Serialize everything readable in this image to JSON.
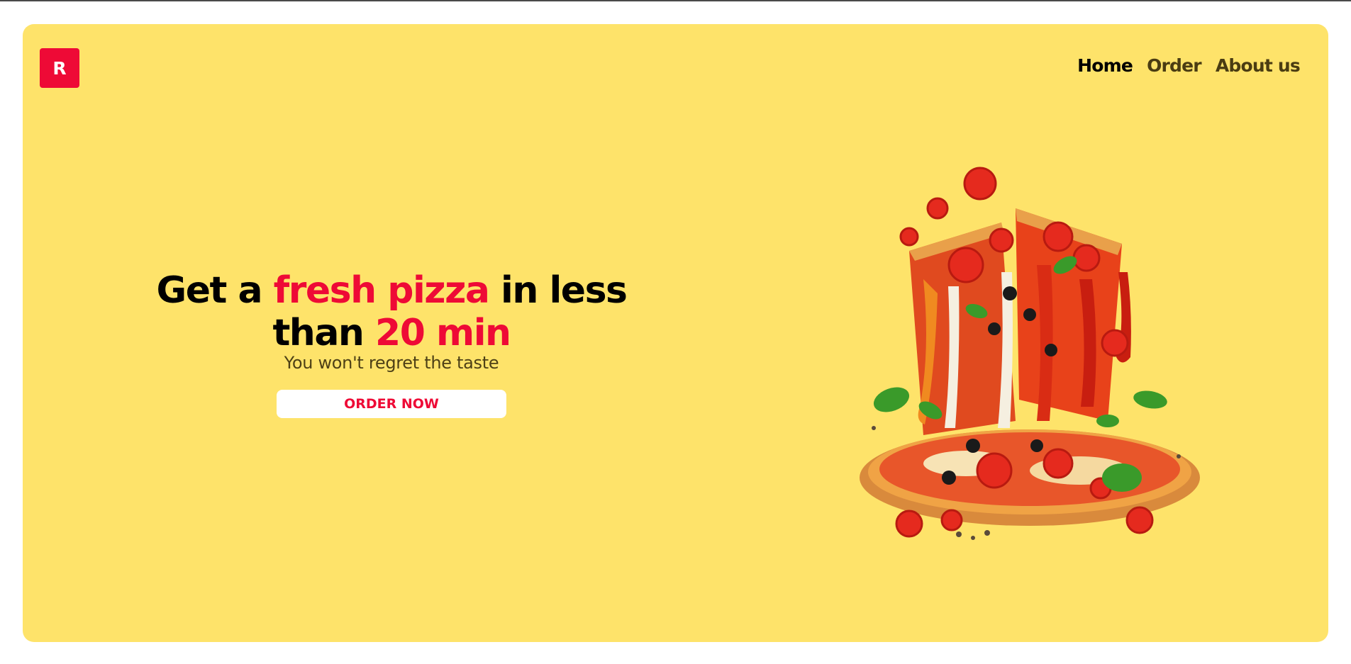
{
  "brand": {
    "logo_letter": "R"
  },
  "nav": {
    "items": [
      {
        "label": "Home",
        "active": true
      },
      {
        "label": "Order",
        "active": false
      },
      {
        "label": "About us",
        "active": false
      }
    ]
  },
  "hero": {
    "headline": {
      "part1": "Get a ",
      "accent1": "fresh pizza",
      "part2": " in less than ",
      "accent2": "20 min"
    },
    "subtitle": "You won't regret the taste",
    "cta_label": "ORDER NOW"
  },
  "image": {
    "subject": "pizza-illustration"
  },
  "colors": {
    "background": "#fee36a",
    "accent": "#ee0a36",
    "text": "#000000",
    "button": "#ffffff"
  }
}
